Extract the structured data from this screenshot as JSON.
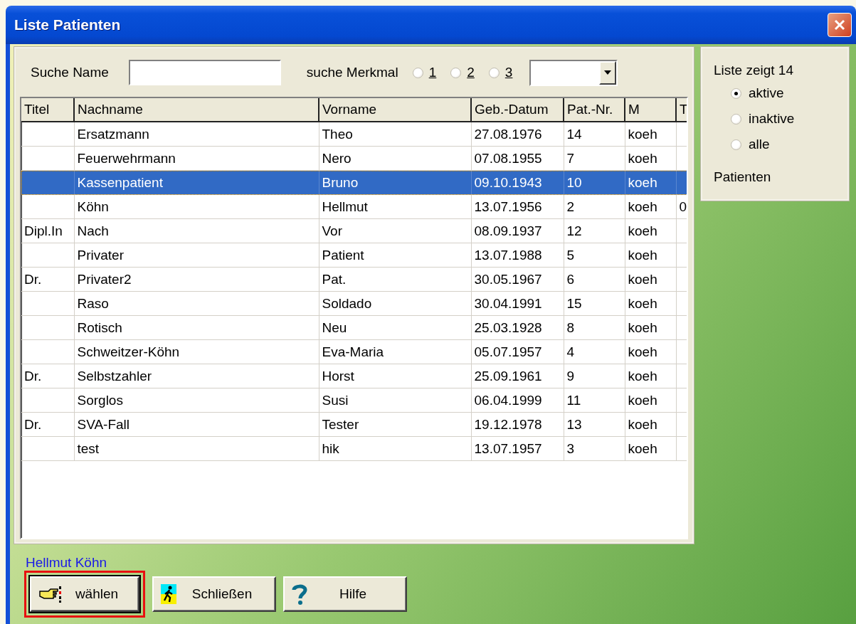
{
  "window": {
    "title": "Liste Patienten"
  },
  "search": {
    "label": "Suche Name"
  },
  "feature": {
    "label": "suche Merkmal",
    "options": [
      {
        "label": "1",
        "selected": false
      },
      {
        "label": "2",
        "selected": false
      },
      {
        "label": "3",
        "selected": false
      }
    ]
  },
  "table": {
    "columns": [
      "Titel",
      "Nachname",
      "Vorname",
      "Geb.-Datum",
      "Pat.-Nr.",
      "M",
      "T"
    ],
    "rows": [
      {
        "cells": [
          "",
          "Ersatzmann",
          "Theo",
          "27.08.1976",
          "14",
          "koeh",
          ""
        ],
        "selected": false
      },
      {
        "cells": [
          "",
          "Feuerwehrmann",
          "Nero",
          "07.08.1955",
          "7",
          "koeh",
          ""
        ],
        "selected": false
      },
      {
        "cells": [
          "",
          "Kassenpatient",
          "Bruno",
          "09.10.1943",
          "10",
          "koeh",
          ""
        ],
        "selected": true
      },
      {
        "cells": [
          "",
          "Köhn",
          "Hellmut",
          "13.07.1956",
          "2",
          "koeh",
          "0"
        ],
        "selected": false
      },
      {
        "cells": [
          "Dipl.In",
          "Nach",
          "Vor",
          "08.09.1937",
          "12",
          "koeh",
          ""
        ],
        "selected": false
      },
      {
        "cells": [
          "",
          "Privater",
          "Patient",
          "13.07.1988",
          "5",
          "koeh",
          ""
        ],
        "selected": false
      },
      {
        "cells": [
          "Dr.",
          "Privater2",
          "Pat.",
          "30.05.1967",
          "6",
          "koeh",
          ""
        ],
        "selected": false
      },
      {
        "cells": [
          "",
          "Raso",
          "Soldado",
          "30.04.1991",
          "15",
          "koeh",
          ""
        ],
        "selected": false
      },
      {
        "cells": [
          "",
          "Rotisch",
          "Neu",
          "25.03.1928",
          "8",
          "koeh",
          ""
        ],
        "selected": false
      },
      {
        "cells": [
          "",
          "Schweitzer-Köhn",
          "Eva-Maria",
          "05.07.1957",
          "4",
          "koeh",
          ""
        ],
        "selected": false
      },
      {
        "cells": [
          "Dr.",
          "Selbstzahler",
          "Horst",
          "25.09.1961",
          "9",
          "koeh",
          ""
        ],
        "selected": false
      },
      {
        "cells": [
          "",
          "Sorglos",
          "Susi",
          "06.04.1999",
          "11",
          "koeh",
          ""
        ],
        "selected": false
      },
      {
        "cells": [
          "Dr.",
          "SVA-Fall",
          "Tester",
          "19.12.1978",
          "13",
          "koeh",
          ""
        ],
        "selected": false
      },
      {
        "cells": [
          "",
          "test",
          "hik",
          "13.07.1957",
          "3",
          "koeh",
          ""
        ],
        "selected": false
      }
    ]
  },
  "filter": {
    "heading": "Liste zeigt 14",
    "options": [
      {
        "label": "aktive",
        "selected": true
      },
      {
        "label": "inaktive",
        "selected": false
      },
      {
        "label": "alle",
        "selected": false
      }
    ],
    "footer": "Patienten"
  },
  "current_patient": "Hellmut Köhn",
  "buttons": [
    {
      "kind": "select",
      "label": "wählen",
      "highlighted": true
    },
    {
      "kind": "close",
      "label": "Schließen",
      "highlighted": false
    },
    {
      "kind": "help",
      "label": "Hilfe",
      "highlighted": false
    }
  ]
}
